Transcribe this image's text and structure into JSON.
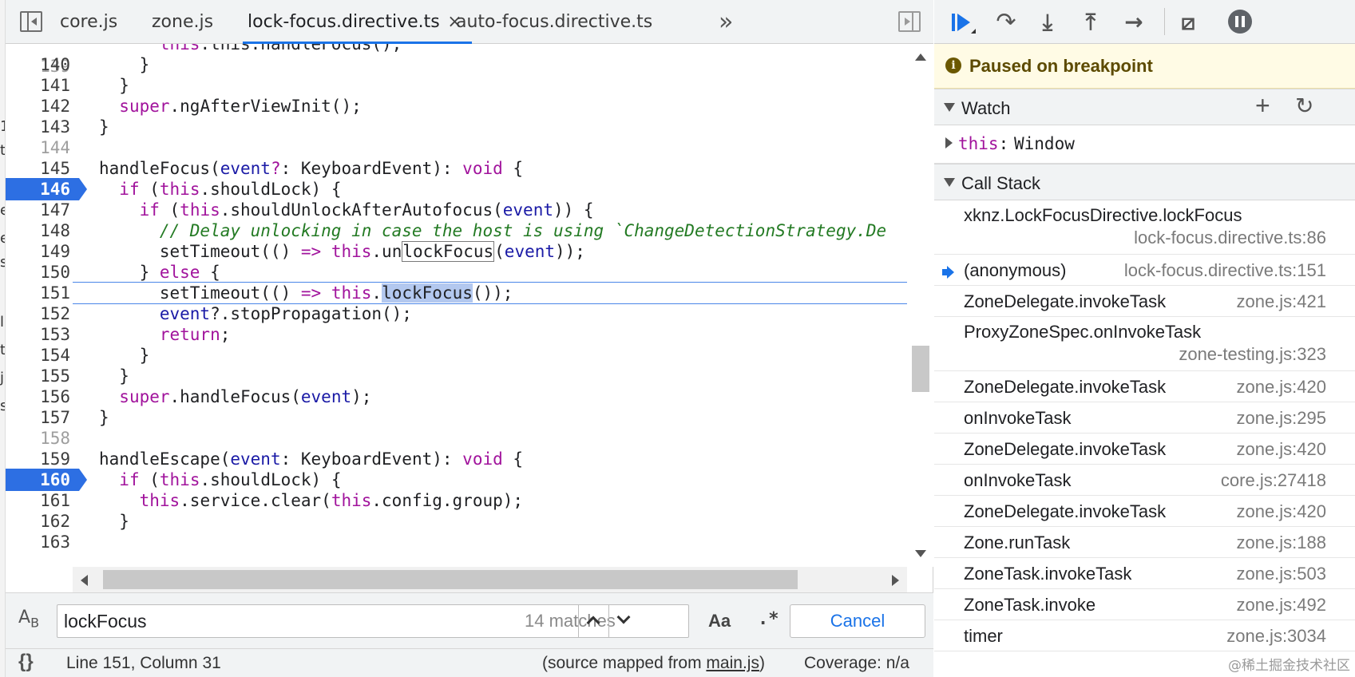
{
  "tabs": [
    {
      "label": "core.js"
    },
    {
      "label": "zone.js"
    },
    {
      "label": "lock-focus.directive.ts",
      "close": "×"
    },
    {
      "label": "auto-focus.directive.ts"
    }
  ],
  "tab_overflow": "»",
  "left_strip_chars": [
    "1",
    "t",
    "e",
    "e",
    "s",
    "l",
    "t",
    "j",
    "s"
  ],
  "code": {
    "partial_line_text": "this.handleFocus();",
    "lines": [
      {
        "n": "140",
        "t": "    }"
      },
      {
        "n": "141",
        "t": "  }"
      },
      {
        "n": "142",
        "t": "  super.ngAfterViewInit();"
      },
      {
        "n": "143",
        "t": "}"
      },
      {
        "n": "144",
        "t": ""
      },
      {
        "n": "145",
        "t": "handleFocus(event?: KeyboardEvent): void {"
      },
      {
        "n": "146",
        "t": "  if (this.shouldLock) {"
      },
      {
        "n": "147",
        "t": "    if (this.shouldUnlockAfterAutofocus(event)) {"
      },
      {
        "n": "148",
        "t": "      // Delay unlocking in case the host is using `ChangeDetectionStrategy.De"
      },
      {
        "n": "149",
        "t": "      setTimeout(() => this.unlockFocus(event));"
      },
      {
        "n": "150",
        "t": "    } else {"
      },
      {
        "n": "151",
        "t": "      setTimeout(() => this.lockFocus());"
      },
      {
        "n": "152",
        "t": "      event?.stopPropagation();"
      },
      {
        "n": "153",
        "t": "      return;"
      },
      {
        "n": "154",
        "t": "    }"
      },
      {
        "n": "155",
        "t": "  }"
      },
      {
        "n": "156",
        "t": "  super.handleFocus(event);"
      },
      {
        "n": "157",
        "t": "}"
      },
      {
        "n": "158",
        "t": ""
      },
      {
        "n": "159",
        "t": "handleEscape(event: KeyboardEvent): void {"
      },
      {
        "n": "160",
        "t": "  if (this.shouldLock) {"
      },
      {
        "n": "161",
        "t": "    this.service.clear(this.config.group);"
      },
      {
        "n": "162",
        "t": "  }"
      },
      {
        "n": "163",
        "t": ""
      }
    ],
    "breakpoint_lines": [
      "146",
      "160"
    ],
    "current_line": "151"
  },
  "search": {
    "icon_label": "A",
    "icon_label_sub": "B",
    "query": "lockFocus",
    "match_count": "14 matches",
    "match_case_label": "Aa",
    "regex_label": ".*",
    "cancel_label": "Cancel"
  },
  "status": {
    "braces": "{}",
    "position": "Line 151, Column 31",
    "source_prefix": "(source mapped from ",
    "source_file": "main.js",
    "source_suffix": ")",
    "coverage": "Coverage: n/a"
  },
  "debugger": {
    "paused_text": "Paused on breakpoint",
    "watch_label": "Watch",
    "watch_add": "+",
    "watch_refresh": "↻",
    "watch_items": [
      {
        "name": "this",
        "sep": ": ",
        "value": "Window"
      }
    ],
    "callstack_label": "Call Stack",
    "frames": [
      {
        "fn": "xknz.LockFocusDirective.lockFocus",
        "loc": "lock-focus.directive.ts:86",
        "two_line": true,
        "current": false
      },
      {
        "fn": "(anonymous)",
        "loc": "lock-focus.directive.ts:151",
        "two_line": false,
        "current": true
      },
      {
        "fn": "ZoneDelegate.invokeTask",
        "loc": "zone.js:421",
        "two_line": false,
        "current": false
      },
      {
        "fn": "ProxyZoneSpec.onInvokeTask",
        "loc": "zone-testing.js:323",
        "two_line": true,
        "current": false
      },
      {
        "fn": "ZoneDelegate.invokeTask",
        "loc": "zone.js:420",
        "two_line": false,
        "current": false
      },
      {
        "fn": "onInvokeTask",
        "loc": "zone.js:295",
        "two_line": false,
        "current": false
      },
      {
        "fn": "ZoneDelegate.invokeTask",
        "loc": "zone.js:420",
        "two_line": false,
        "current": false
      },
      {
        "fn": "onInvokeTask",
        "loc": "core.js:27418",
        "two_line": false,
        "current": false
      },
      {
        "fn": "ZoneDelegate.invokeTask",
        "loc": "zone.js:420",
        "two_line": false,
        "current": false
      },
      {
        "fn": "Zone.runTask",
        "loc": "zone.js:188",
        "two_line": false,
        "current": false
      },
      {
        "fn": "ZoneTask.invokeTask",
        "loc": "zone.js:503",
        "two_line": false,
        "current": false
      },
      {
        "fn": "ZoneTask.invoke",
        "loc": "zone.js:492",
        "two_line": false,
        "current": false
      },
      {
        "fn": "timer",
        "loc": "zone.js:3034",
        "two_line": false,
        "current": false
      }
    ]
  },
  "watermark": "@稀土掘金技术社区",
  "colors": {
    "accent": "#1a73e8",
    "breakpoint": "#2d6fe3",
    "keyword": "#a1139c",
    "param": "#1a1aa6",
    "comment": "#237a23",
    "paused_bg": "#fffbe5"
  }
}
